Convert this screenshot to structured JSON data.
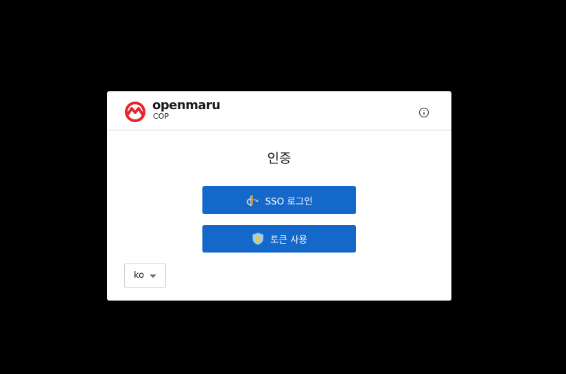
{
  "header": {
    "brand_name": "openmaru",
    "brand_sub": "COP",
    "logo_icon": "openmaru-logo-icon",
    "info_icon": "info-icon"
  },
  "main": {
    "title": "인증",
    "sso_button": {
      "label": "SSO 로그인",
      "icon": "openid-icon"
    },
    "token_button": {
      "label": "토큰 사용",
      "icon": "shield-lock-icon"
    }
  },
  "language": {
    "selected": "ko"
  },
  "colors": {
    "background": "#000000",
    "card": "#ffffff",
    "primary": "#1468c9",
    "logo_red": "#e8242c",
    "text": "#151515"
  }
}
